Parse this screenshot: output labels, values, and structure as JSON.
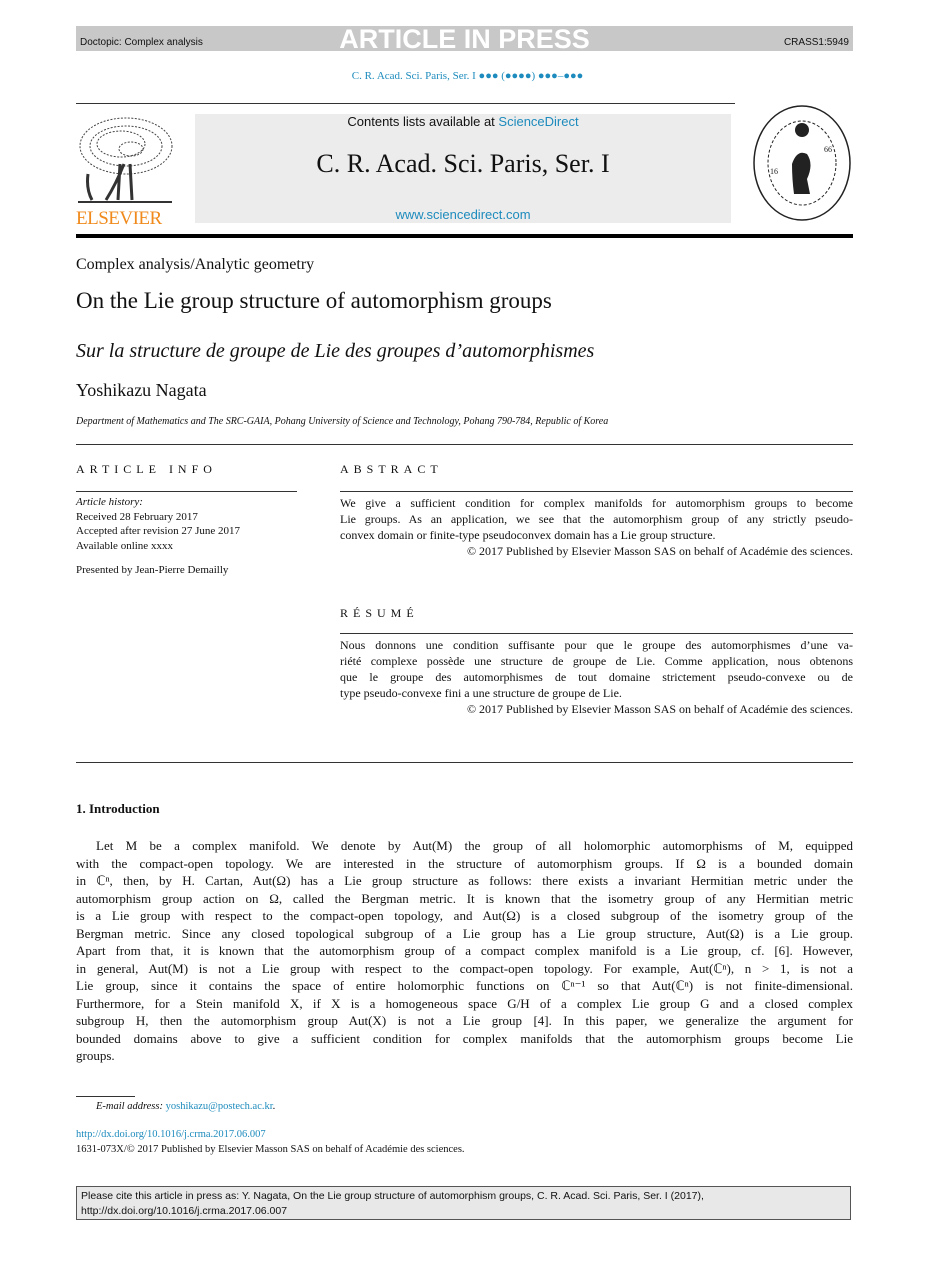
{
  "banner": {
    "doctopic": "Doctopic: Complex analysis",
    "status": "ARTICLE IN PRESS",
    "code": "CRASS1:5949"
  },
  "journal_ref": "C. R. Acad. Sci. Paris, Ser. I ●●● (●●●●) ●●●–●●●",
  "masthead": {
    "contents_prefix": "Contents lists available at ",
    "contents_link": "ScienceDirect",
    "journal_title": "C. R. Acad. Sci. Paris, Ser. I",
    "url": "www.sciencedirect.com",
    "publisher_logo": "ELSEVIER",
    "seal": "INSTITUT DE FRANCE ACADÉMIE DES SCIENCES 1666"
  },
  "article": {
    "section": "Complex analysis/Analytic geometry",
    "title": "On the Lie group structure of automorphism groups",
    "title_fr": "Sur la structure de groupe de Lie des groupes d’automorphismes",
    "author": "Yoshikazu Nagata",
    "affiliation": "Department of Mathematics and The SRC-GAIA, Pohang University of Science and Technology, Pohang 790-784, Republic of Korea"
  },
  "info": {
    "heading": "ARTICLE INFO",
    "history_label": "Article history:",
    "received": "Received 28 February 2017",
    "accepted": "Accepted after revision 27 June 2017",
    "online": "Available online xxxx",
    "presented": "Presented by Jean-Pierre Demailly"
  },
  "abstract": {
    "heading": "ABSTRACT",
    "lines": [
      "We give a sufficient condition for complex manifolds for automorphism groups to become",
      "Lie groups. As an application, we see that the automorphism group of any strictly pseudo-",
      "convex domain or finite-type pseudoconvex domain has a Lie group structure."
    ],
    "copyright": "© 2017 Published by Elsevier Masson SAS on behalf of Académie des sciences."
  },
  "resume": {
    "heading": "RÉSUMÉ",
    "lines": [
      "Nous donnons une condition suffisante pour que le groupe des automorphismes d’une va-",
      "riété complexe possède une structure de groupe de Lie. Comme application, nous obtenons",
      "que le groupe des automorphismes de tout domaine strictement pseudo-convexe ou de",
      "type pseudo-convexe fini a une structure de groupe de Lie."
    ],
    "copyright": "© 2017 Published by Elsevier Masson SAS on behalf of Académie des sciences."
  },
  "intro": {
    "heading": "1. Introduction",
    "lines": [
      "    Let M be a complex manifold. We denote by Aut(M) the group of all holomorphic automorphisms of M, equipped",
      "with the compact-open topology. We are interested in the structure of automorphism groups. If Ω is a bounded domain",
      "in ℂⁿ, then, by H. Cartan, Aut(Ω) has a Lie group structure as follows: there exists a invariant Hermitian metric under the",
      "automorphism group action on Ω, called the Bergman metric. It is known that the isometry group of any Hermitian metric",
      "is a Lie group with respect to the compact-open topology, and Aut(Ω) is a closed subgroup of the isometry group of the",
      "Bergman metric. Since any closed topological subgroup of a Lie group has a Lie group structure, Aut(Ω) is a Lie group.",
      "Apart from that, it is known that the automorphism group of a compact complex manifold is a Lie group, cf. [6]. However,",
      "in general, Aut(M) is not a Lie group with respect to the compact-open topology. For example, Aut(ℂⁿ), n > 1, is not a",
      "Lie group, since it contains the space of entire holomorphic functions on ℂⁿ⁻¹ so that Aut(ℂⁿ) is not finite-dimensional.",
      "Furthermore, for a Stein manifold X, if X is a homogeneous space G/H of a complex Lie group G and a closed complex",
      "subgroup H, then the automorphism group Aut(X) is not a Lie group [4]. In this paper, we generalize the argument for",
      "bounded domains above to give a sufficient condition for complex manifolds that the automorphism groups become Lie",
      "groups."
    ]
  },
  "footnote": {
    "email_label": "E-mail address: ",
    "email": "yoshikazu@postech.ac.kr",
    "email_end": ".",
    "doi": "http://dx.doi.org/10.1016/j.crma.2017.06.007",
    "issn": "1631-073X/© 2017 Published by Elsevier Masson SAS on behalf of Académie des sciences."
  },
  "cite": {
    "line1": "Please cite this article in press as: Y. Nagata, On the Lie group structure of automorphism groups, C. R. Acad. Sci. Paris, Ser. I (2017),",
    "line2": "http://dx.doi.org/10.1016/j.crma.2017.06.007"
  },
  "colors": {
    "link": "#1d8bbd",
    "banner": "#c8c8c8",
    "elsevier": "#f08a1c"
  }
}
